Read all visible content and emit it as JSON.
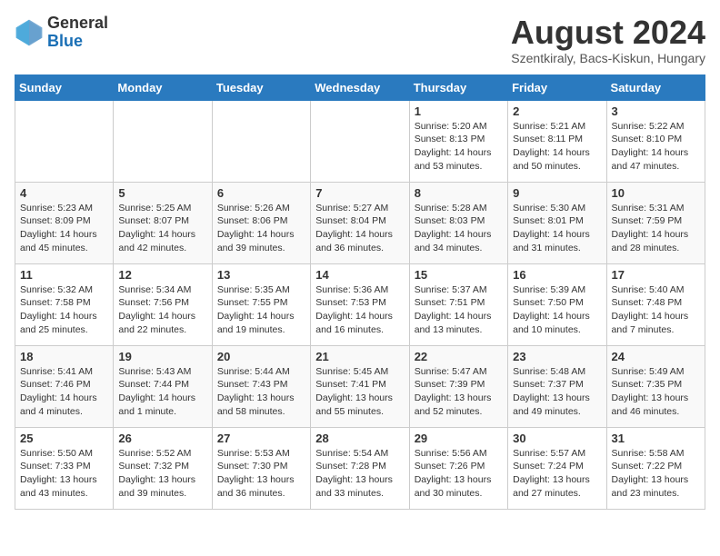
{
  "header": {
    "logo_general": "General",
    "logo_blue": "Blue",
    "month_year": "August 2024",
    "location": "Szentkiraly, Bacs-Kiskun, Hungary"
  },
  "days_of_week": [
    "Sunday",
    "Monday",
    "Tuesday",
    "Wednesday",
    "Thursday",
    "Friday",
    "Saturday"
  ],
  "weeks": [
    [
      {
        "day": "",
        "info": ""
      },
      {
        "day": "",
        "info": ""
      },
      {
        "day": "",
        "info": ""
      },
      {
        "day": "",
        "info": ""
      },
      {
        "day": "1",
        "info": "Sunrise: 5:20 AM\nSunset: 8:13 PM\nDaylight: 14 hours\nand 53 minutes."
      },
      {
        "day": "2",
        "info": "Sunrise: 5:21 AM\nSunset: 8:11 PM\nDaylight: 14 hours\nand 50 minutes."
      },
      {
        "day": "3",
        "info": "Sunrise: 5:22 AM\nSunset: 8:10 PM\nDaylight: 14 hours\nand 47 minutes."
      }
    ],
    [
      {
        "day": "4",
        "info": "Sunrise: 5:23 AM\nSunset: 8:09 PM\nDaylight: 14 hours\nand 45 minutes."
      },
      {
        "day": "5",
        "info": "Sunrise: 5:25 AM\nSunset: 8:07 PM\nDaylight: 14 hours\nand 42 minutes."
      },
      {
        "day": "6",
        "info": "Sunrise: 5:26 AM\nSunset: 8:06 PM\nDaylight: 14 hours\nand 39 minutes."
      },
      {
        "day": "7",
        "info": "Sunrise: 5:27 AM\nSunset: 8:04 PM\nDaylight: 14 hours\nand 36 minutes."
      },
      {
        "day": "8",
        "info": "Sunrise: 5:28 AM\nSunset: 8:03 PM\nDaylight: 14 hours\nand 34 minutes."
      },
      {
        "day": "9",
        "info": "Sunrise: 5:30 AM\nSunset: 8:01 PM\nDaylight: 14 hours\nand 31 minutes."
      },
      {
        "day": "10",
        "info": "Sunrise: 5:31 AM\nSunset: 7:59 PM\nDaylight: 14 hours\nand 28 minutes."
      }
    ],
    [
      {
        "day": "11",
        "info": "Sunrise: 5:32 AM\nSunset: 7:58 PM\nDaylight: 14 hours\nand 25 minutes."
      },
      {
        "day": "12",
        "info": "Sunrise: 5:34 AM\nSunset: 7:56 PM\nDaylight: 14 hours\nand 22 minutes."
      },
      {
        "day": "13",
        "info": "Sunrise: 5:35 AM\nSunset: 7:55 PM\nDaylight: 14 hours\nand 19 minutes."
      },
      {
        "day": "14",
        "info": "Sunrise: 5:36 AM\nSunset: 7:53 PM\nDaylight: 14 hours\nand 16 minutes."
      },
      {
        "day": "15",
        "info": "Sunrise: 5:37 AM\nSunset: 7:51 PM\nDaylight: 14 hours\nand 13 minutes."
      },
      {
        "day": "16",
        "info": "Sunrise: 5:39 AM\nSunset: 7:50 PM\nDaylight: 14 hours\nand 10 minutes."
      },
      {
        "day": "17",
        "info": "Sunrise: 5:40 AM\nSunset: 7:48 PM\nDaylight: 14 hours\nand 7 minutes."
      }
    ],
    [
      {
        "day": "18",
        "info": "Sunrise: 5:41 AM\nSunset: 7:46 PM\nDaylight: 14 hours\nand 4 minutes."
      },
      {
        "day": "19",
        "info": "Sunrise: 5:43 AM\nSunset: 7:44 PM\nDaylight: 14 hours\nand 1 minute."
      },
      {
        "day": "20",
        "info": "Sunrise: 5:44 AM\nSunset: 7:43 PM\nDaylight: 13 hours\nand 58 minutes."
      },
      {
        "day": "21",
        "info": "Sunrise: 5:45 AM\nSunset: 7:41 PM\nDaylight: 13 hours\nand 55 minutes."
      },
      {
        "day": "22",
        "info": "Sunrise: 5:47 AM\nSunset: 7:39 PM\nDaylight: 13 hours\nand 52 minutes."
      },
      {
        "day": "23",
        "info": "Sunrise: 5:48 AM\nSunset: 7:37 PM\nDaylight: 13 hours\nand 49 minutes."
      },
      {
        "day": "24",
        "info": "Sunrise: 5:49 AM\nSunset: 7:35 PM\nDaylight: 13 hours\nand 46 minutes."
      }
    ],
    [
      {
        "day": "25",
        "info": "Sunrise: 5:50 AM\nSunset: 7:33 PM\nDaylight: 13 hours\nand 43 minutes."
      },
      {
        "day": "26",
        "info": "Sunrise: 5:52 AM\nSunset: 7:32 PM\nDaylight: 13 hours\nand 39 minutes."
      },
      {
        "day": "27",
        "info": "Sunrise: 5:53 AM\nSunset: 7:30 PM\nDaylight: 13 hours\nand 36 minutes."
      },
      {
        "day": "28",
        "info": "Sunrise: 5:54 AM\nSunset: 7:28 PM\nDaylight: 13 hours\nand 33 minutes."
      },
      {
        "day": "29",
        "info": "Sunrise: 5:56 AM\nSunset: 7:26 PM\nDaylight: 13 hours\nand 30 minutes."
      },
      {
        "day": "30",
        "info": "Sunrise: 5:57 AM\nSunset: 7:24 PM\nDaylight: 13 hours\nand 27 minutes."
      },
      {
        "day": "31",
        "info": "Sunrise: 5:58 AM\nSunset: 7:22 PM\nDaylight: 13 hours\nand 23 minutes."
      }
    ]
  ]
}
